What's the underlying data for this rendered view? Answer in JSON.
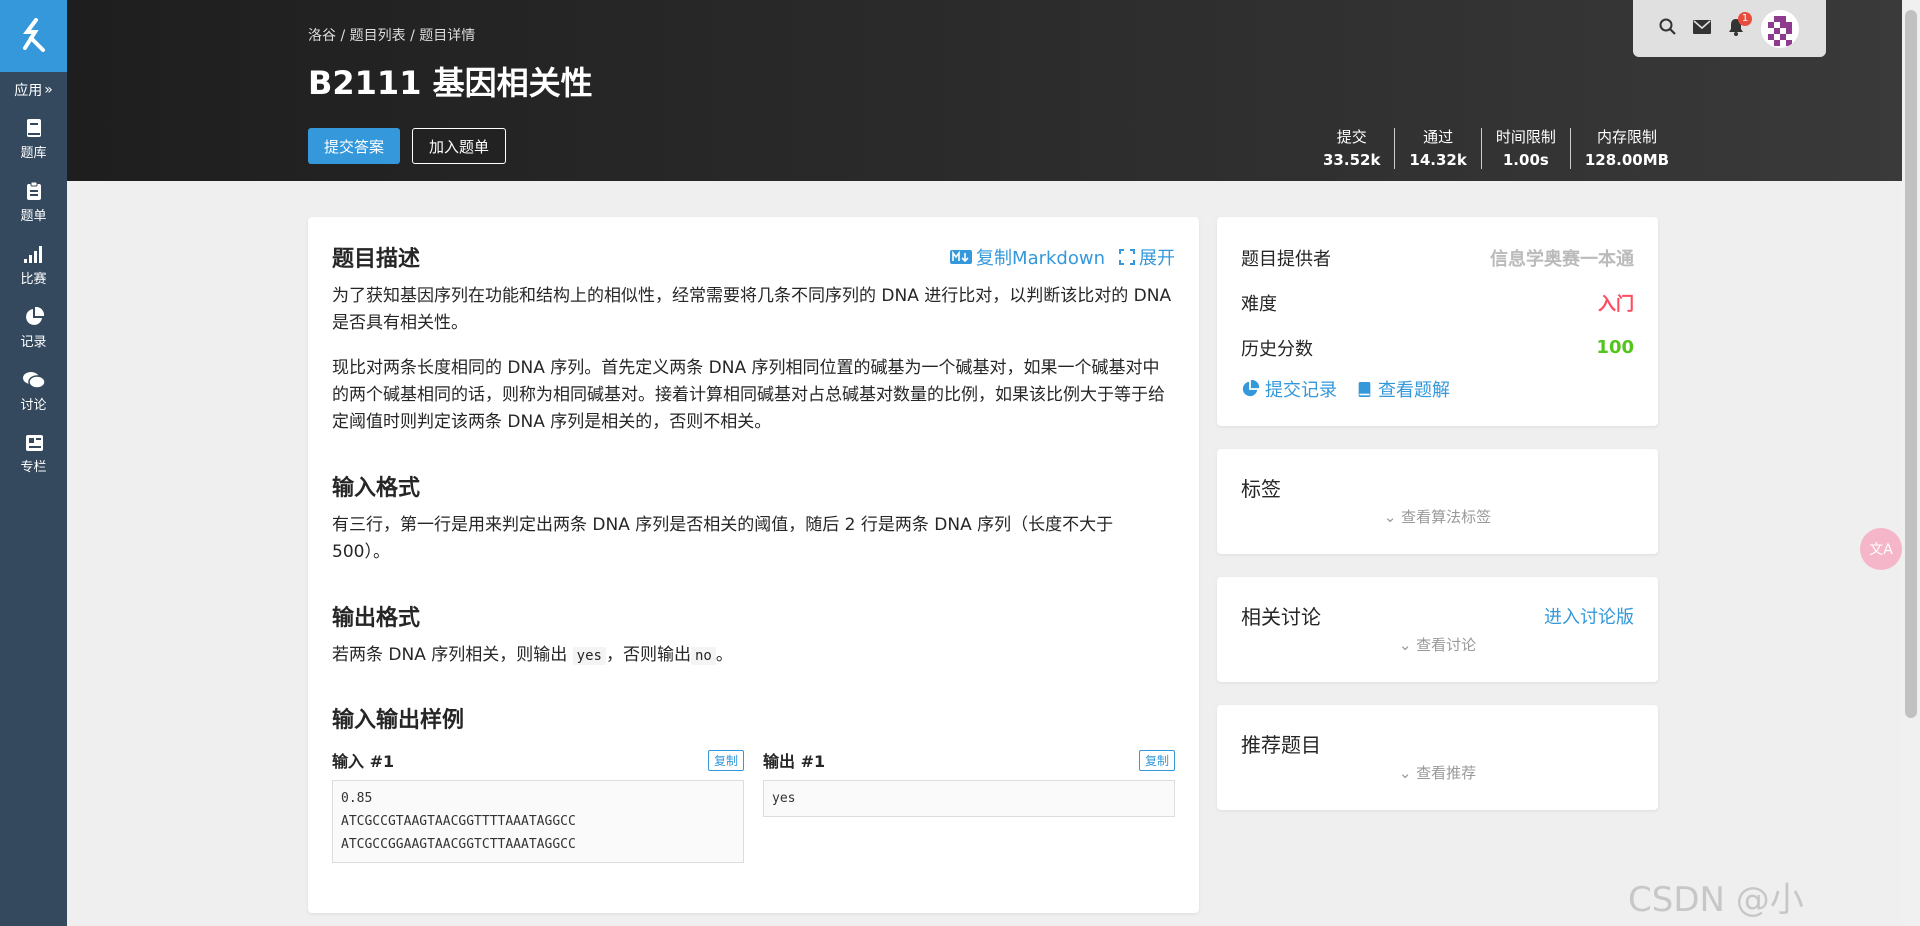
{
  "sidebar": {
    "apps_label": "应用",
    "items": [
      {
        "label": "题库",
        "icon": "book-icon"
      },
      {
        "label": "题单",
        "icon": "clipboard-icon"
      },
      {
        "label": "比赛",
        "icon": "signal-bars-icon"
      },
      {
        "label": "记录",
        "icon": "pie-chart-icon"
      },
      {
        "label": "讨论",
        "icon": "comments-icon"
      },
      {
        "label": "专栏",
        "icon": "newspaper-icon"
      }
    ]
  },
  "header": {
    "breadcrumb": [
      "洛谷",
      "题目列表",
      "题目详情"
    ],
    "separator": " / ",
    "title": "B2111 基因相关性",
    "submit_label": "提交答案",
    "join_label": "加入题单",
    "stats": [
      {
        "label": "提交",
        "value": "33.52k"
      },
      {
        "label": "通过",
        "value": "14.32k"
      },
      {
        "label": "时间限制",
        "value": "1.00s"
      },
      {
        "label": "内存限制",
        "value": "128.00MB"
      }
    ],
    "notification_count": "1"
  },
  "problem": {
    "desc_title": "题目描述",
    "copy_markdown": "复制Markdown",
    "expand": "展开",
    "desc_p1": "为了获知基因序列在功能和结构上的相似性，经常需要将几条不同序列的 DNA 进行比对，以判断该比对的 DNA 是否具有相关性。",
    "desc_p2": "现比对两条长度相同的 DNA 序列。首先定义两条 DNA 序列相同位置的碱基为一个碱基对，如果一个碱基对中的两个碱基相同的话，则称为相同碱基对。接着计算相同碱基对占总碱基对数量的比例，如果该比例大于等于给定阈值时则判定该两条 DNA 序列是相关的，否则不相关。",
    "input_title": "输入格式",
    "input_text": "有三行，第一行是用来判定出两条 DNA 序列是否相关的阈值，随后 2 行是两条 DNA 序列（长度不大于 500）。",
    "output_title": "输出格式",
    "output_pre": "若两条 DNA 序列相关，则输出",
    "output_yes": "yes",
    "output_mid": "，否则输出",
    "output_no": "no",
    "output_end": "。",
    "samples_title": "输入输出样例",
    "input_label": "输入 #1",
    "output_label": "输出 #1",
    "copy_label": "复制",
    "sample_input": "0.85\nATCGCCGTAAGTAACGGTTTTAAATAGGCC\nATCGCCGGAAGTAACGGTCTTAAATAGGCC",
    "sample_output": "yes"
  },
  "info": {
    "provider_label": "题目提供者",
    "provider_value": "信息学奥赛一本通",
    "difficulty_label": "难度",
    "difficulty_value": "入门",
    "difficulty_color": "#fe4c61",
    "history_label": "历史分数",
    "history_value": "100",
    "history_color": "#52c41a",
    "submit_record": "提交记录",
    "view_solution": "查看题解"
  },
  "tags": {
    "title": "标签",
    "expander": "查看算法标签"
  },
  "discuss": {
    "title": "相关讨论",
    "link": "进入讨论版",
    "expander": "查看讨论"
  },
  "recommend": {
    "title": "推荐题目",
    "expander": "查看推荐"
  },
  "float_button": "文A",
  "watermark": "CSDN @小"
}
